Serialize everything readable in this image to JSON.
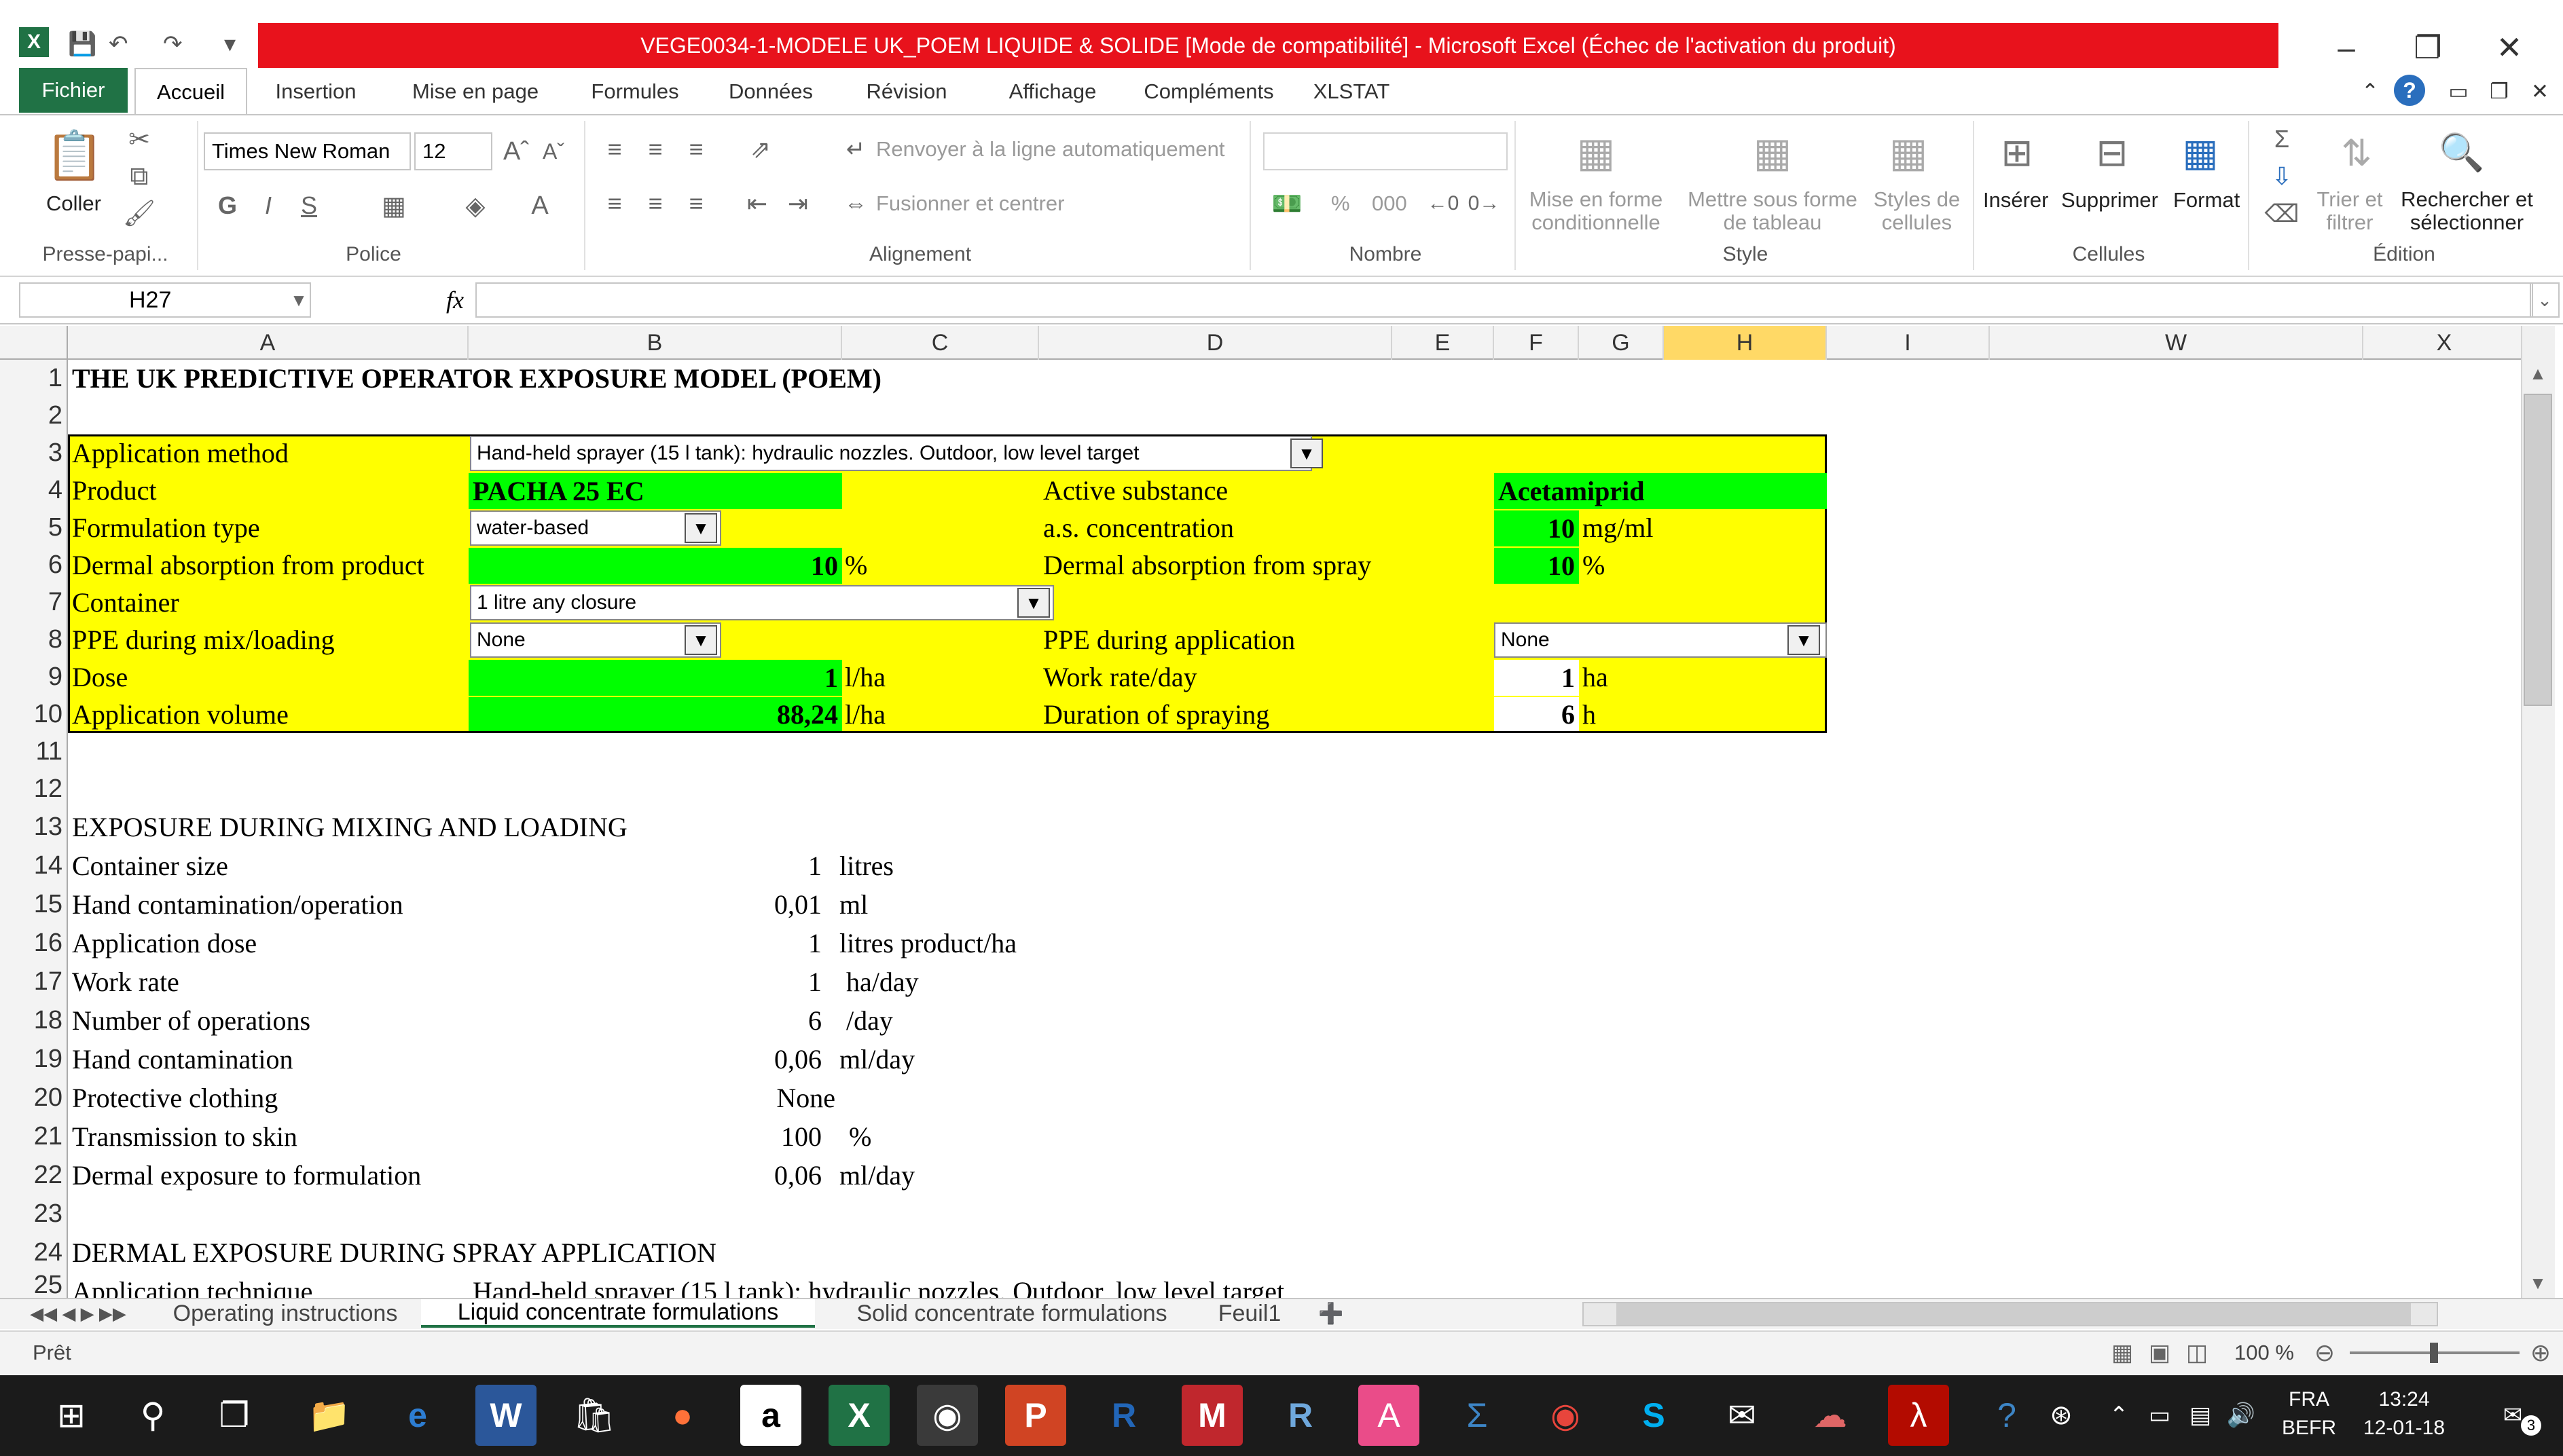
{
  "window": {
    "title": "VEGE0034-1-MODELE UK_POEM LIQUIDE & SOLIDE  [Mode de compatibilité] - Microsoft Excel (Échec de l'activation du produit)"
  },
  "menu": {
    "fichier": "Fichier",
    "tabs": [
      "Accueil",
      "Insertion",
      "Mise en page",
      "Formules",
      "Données",
      "Révision",
      "Affichage",
      "Compléments",
      "XLSTAT"
    ]
  },
  "ribbon": {
    "clipboard": {
      "paste": "Coller",
      "group": "Presse-papi..."
    },
    "police": {
      "font": "Times New Roman",
      "size": "12",
      "group": "Police"
    },
    "alignement": {
      "wrap": "Renvoyer à la ligne automatiquement",
      "merge": "Fusionner et centrer",
      "group": "Alignement"
    },
    "nombre": {
      "percent": "%",
      "thousands": "000",
      "group": "Nombre"
    },
    "style": {
      "cond": "Mise en forme conditionnelle",
      "table": "Mettre sous forme de tableau",
      "cell": "Styles de cellules",
      "group": "Style"
    },
    "cellules": {
      "insert": "Insérer",
      "delete": "Supprimer",
      "format": "Format",
      "group": "Cellules"
    },
    "edition": {
      "sort": "Trier et filtrer",
      "find": "Rechercher et sélectionner",
      "group": "Édition"
    }
  },
  "formula_bar": {
    "name_box": "H27",
    "fx": "fx",
    "formula": ""
  },
  "columns": [
    "A",
    "B",
    "C",
    "D",
    "E",
    "F",
    "G",
    "H",
    "I",
    "W",
    "X"
  ],
  "rows": [
    "1",
    "2",
    "3",
    "4",
    "5",
    "6",
    "7",
    "8",
    "9",
    "10",
    "11",
    "12",
    "13",
    "14",
    "15",
    "16",
    "17",
    "18",
    "19",
    "20",
    "21",
    "22",
    "23",
    "24",
    "25"
  ],
  "sheet": {
    "title": "THE UK PREDICTIVE OPERATOR EXPOSURE MODEL (POEM)",
    "input": {
      "application_method_label": "Application method",
      "application_method_value": "Hand-held sprayer (15 l tank): hydraulic nozzles. Outdoor, low level target",
      "product_label": "Product",
      "product_value": "PACHA 25 EC",
      "active_substance_label": "Active substance",
      "active_substance_value": "Acetamiprid",
      "formulation_type_label": "Formulation type",
      "formulation_type_value": "water-based",
      "as_concentration_label": "a.s. concentration",
      "as_concentration_value": "10",
      "as_concentration_unit": "mg/ml",
      "dermal_product_label": "Dermal absorption from product",
      "dermal_product_value": "10",
      "dermal_product_unit": "%",
      "dermal_spray_label": "Dermal absorption from spray",
      "dermal_spray_value": "10",
      "dermal_spray_unit": "%",
      "container_label": "Container",
      "container_value": "1 litre any closure",
      "ppe_mix_label": "PPE during mix/loading",
      "ppe_mix_value": "None",
      "ppe_app_label": "PPE during application",
      "ppe_app_value": "None",
      "dose_label": "Dose",
      "dose_value": "1",
      "dose_unit": "l/ha",
      "work_rate_label": "Work rate/day",
      "work_rate_value": "1",
      "work_rate_unit": "ha",
      "app_volume_label": "Application volume",
      "app_volume_value": "88,24",
      "app_volume_unit": "l/ha",
      "duration_label": "Duration of spraying",
      "duration_value": "6",
      "duration_unit": "h"
    },
    "mixing": {
      "header": "EXPOSURE DURING MIXING AND LOADING",
      "rows": [
        {
          "label": "Container size",
          "value": "1",
          "unit": "litres"
        },
        {
          "label": "Hand contamination/operation",
          "value": "0,01",
          "unit": "ml"
        },
        {
          "label": "Application dose",
          "value": "1",
          "unit": "litres product/ha"
        },
        {
          "label": "Work rate",
          "value": "1",
          "unit": "ha/day"
        },
        {
          "label": "Number of operations",
          "value": "6",
          "unit": "/day"
        },
        {
          "label": "Hand contamination",
          "value": "0,06",
          "unit": "ml/day"
        },
        {
          "label": "Protective clothing",
          "value": "None",
          "unit": ""
        },
        {
          "label": "Transmission to skin",
          "value": "100",
          "unit": "%"
        },
        {
          "label": "Dermal exposure to formulation",
          "value": "0,06",
          "unit": "ml/day"
        }
      ]
    },
    "spray": {
      "header": "DERMAL EXPOSURE DURING SPRAY APPLICATION",
      "row25_label": "Application technique",
      "row25_value": "Hand-held sprayer (15 l tank): hydraulic nozzles. Outdoor, low level target"
    }
  },
  "sheet_tabs": [
    "Operating instructions",
    "Liquid concentrate formulations",
    "Solid concentrate formulations",
    "Feuil1"
  ],
  "status": {
    "ready": "Prêt",
    "zoom": "100 %"
  },
  "taskbar": {
    "lang1": "FRA",
    "lang2": "BEFR",
    "time": "13:24",
    "date": "12-01-18",
    "notif": "3"
  }
}
